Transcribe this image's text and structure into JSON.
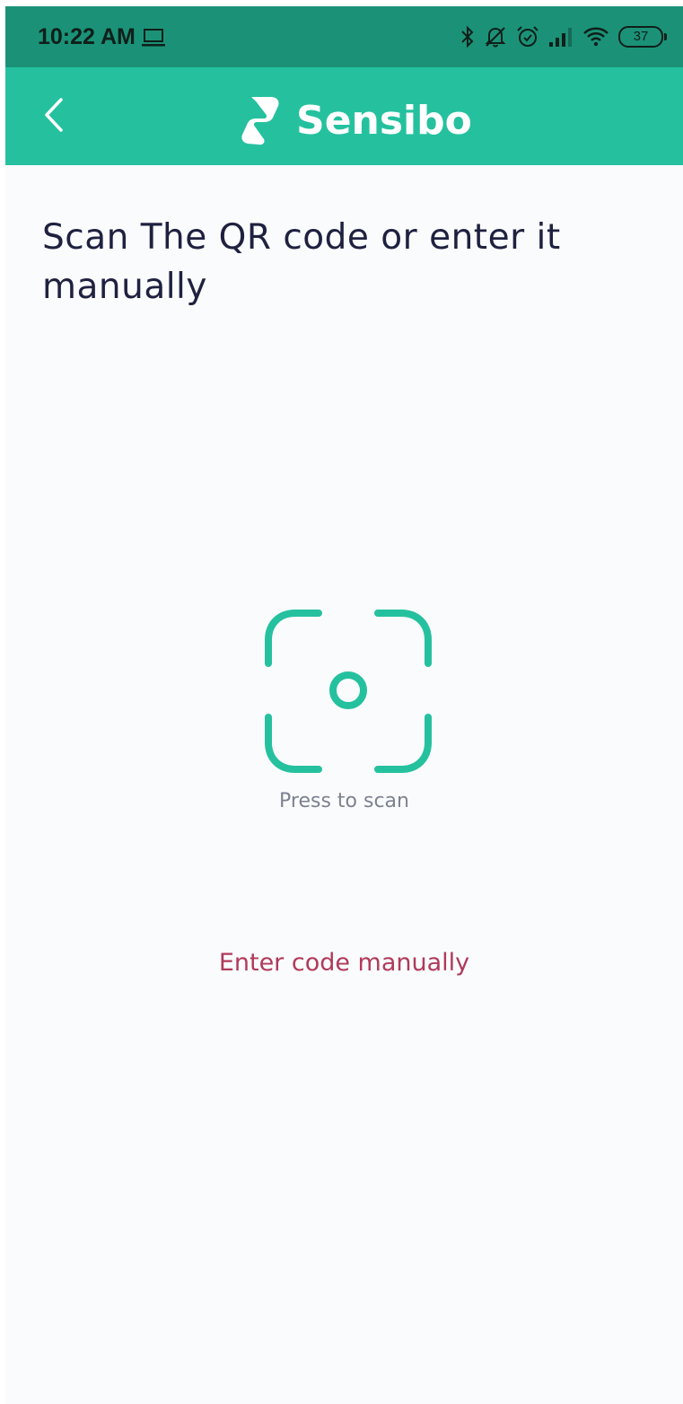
{
  "status_bar": {
    "time": "10:22 AM",
    "battery_level": "37",
    "icons": [
      "laptop-icon",
      "bluetooth-icon",
      "notifications-off-icon",
      "alarm-icon",
      "signal-icon",
      "wifi-icon",
      "battery-icon"
    ]
  },
  "app_bar": {
    "brand_name": "Sensibo",
    "back_icon": "chevron-left-icon"
  },
  "main": {
    "title": "Scan The QR code or enter it manually",
    "scan_label": "Press to scan",
    "manual_link": "Enter code manually"
  },
  "colors": {
    "status_bar": "#1b9277",
    "app_bar": "#25c19f",
    "accent": "#25c19f",
    "link": "#b03a5b",
    "title": "#1f2140",
    "muted": "#7d8291",
    "background": "#fafbfc"
  }
}
